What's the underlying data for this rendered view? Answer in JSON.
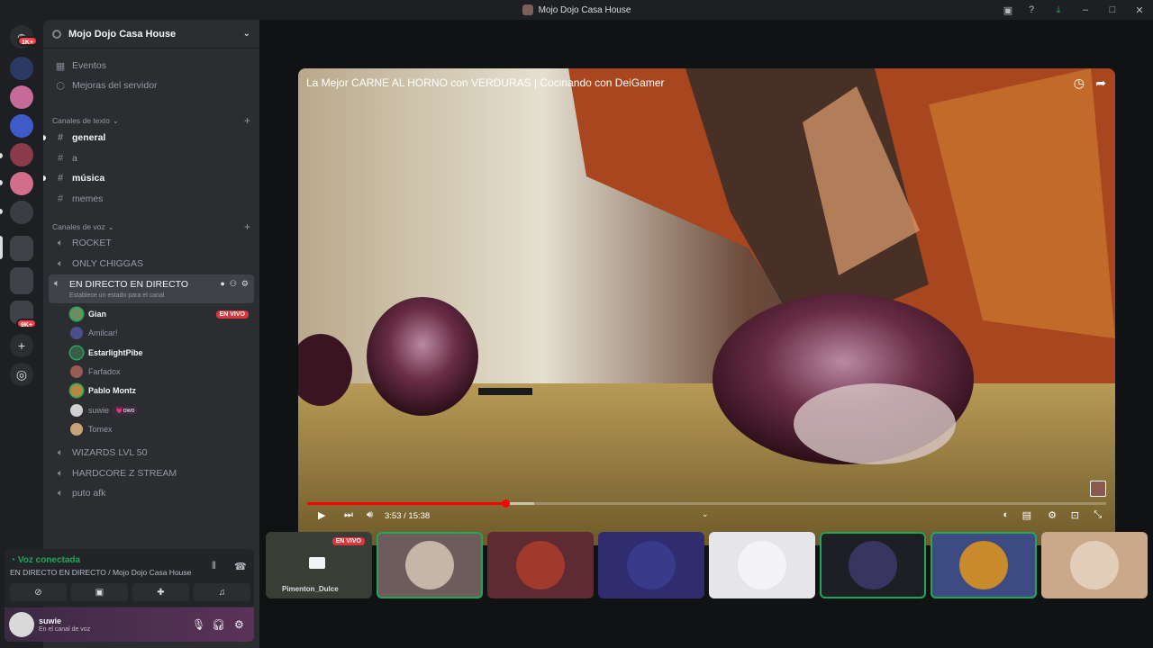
{
  "window": {
    "title": "Mojo Dojo Casa House",
    "icons": [
      "inbox-icon",
      "help-icon",
      "download-icon",
      "minimize-icon",
      "maximize-icon",
      "close-icon"
    ]
  },
  "guilds": {
    "home_badge": "1K+",
    "folder_badge": "9K+",
    "add_glyph": "+",
    "explore_glyph": "◎"
  },
  "server": {
    "name": "Mojo Dojo Casa House",
    "menu_items": [
      "Eventos",
      "Mejoras del servidor"
    ],
    "text_category": "Canales de texto",
    "text_channels": [
      {
        "name": "general",
        "unread": true
      },
      {
        "name": "a",
        "unread": false
      },
      {
        "name": "música",
        "unread": true
      },
      {
        "name": "memes",
        "unread": false
      }
    ],
    "voice_category": "Canales de voz",
    "voice_channels_top": [
      "ROCKET",
      "ONLY CHIGGAS"
    ],
    "active_voice": {
      "name": "EN DIRECTO EN DIRECTO",
      "status_hint": "Establece un estado para el canal"
    },
    "voice_users": [
      {
        "name": "Gian",
        "bold": true,
        "live": "EN VIVO",
        "color": "#6b8f5e"
      },
      {
        "name": "Amilcar!",
        "bold": false,
        "color": "#4b4f8a"
      },
      {
        "name": "EstarlightPibe",
        "bold": true,
        "color": "#3b5c48"
      },
      {
        "name": "Farfadox",
        "bold": false,
        "color": "#9a5a55"
      },
      {
        "name": "Pablo Montz",
        "bold": true,
        "color": "#b38840"
      },
      {
        "name": "suwie",
        "bold": false,
        "tag": "💗owo",
        "color": "#d0d0d0"
      },
      {
        "name": "Tomex",
        "bold": false,
        "color": "#c9a27a"
      }
    ],
    "voice_channels_bottom": [
      "WIZARDS LVL 50",
      "HARDCORE Z STREAM",
      "puto afk"
    ]
  },
  "voice_panel": {
    "status": "Voz conectada",
    "channel": "EN DIRECTO EN DIRECTO / Mojo Dojo Casa House"
  },
  "user": {
    "name": "suwie",
    "status": "En el canal de voz"
  },
  "video": {
    "title": "La Mejor CARNE AL HORNO con VERDURAS | Cocinando con DeiGamer",
    "time": "3:53 / 15:38",
    "played_fraction": 0.248,
    "buffered_fraction": 0.284
  },
  "tiles": [
    {
      "name": "Pimenton_Dulce",
      "live": "EN VIVO",
      "bg": "#3a3d36"
    },
    {
      "bg": "#6e5b5b",
      "circle": "#c4b7a8",
      "speaking": true
    },
    {
      "bg": "#5e2b33",
      "circle": "#a03a2c",
      "speaking": false
    },
    {
      "bg": "#2f2d6e",
      "circle": "#3a3a8a",
      "speaking": false
    },
    {
      "bg": "#e6e6ea",
      "circle": "#f4f4f6",
      "speaking": false
    },
    {
      "bg": "#1d1f24",
      "circle": "#3a3560",
      "speaking": true
    },
    {
      "bg": "#3c4b82",
      "circle": "#c98a2c",
      "speaking": true
    },
    {
      "bg": "#c9a98a",
      "circle": "#e2cdb8",
      "speaking": false
    }
  ],
  "colors": {
    "accent_green": "#23a55a",
    "live_red": "#da373c",
    "progress_red": "#ff0000"
  }
}
